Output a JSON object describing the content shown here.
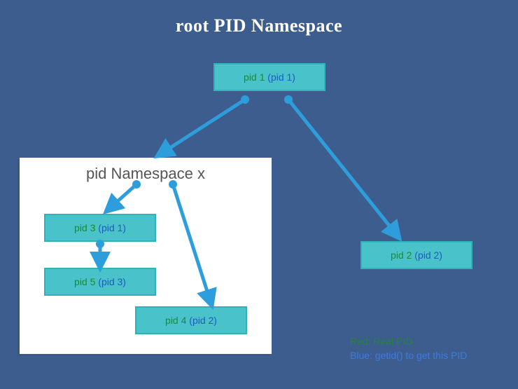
{
  "title": "root PID Namespace",
  "namespace_label": "pid Namespace x",
  "nodes": {
    "pid1": {
      "real": "pid 1",
      "virt": "(pid 1)"
    },
    "pid2": {
      "real": "pid 2",
      "virt": "(pid 2)"
    },
    "pid3": {
      "real": "pid 3",
      "virt": "(pid 1)"
    },
    "pid4": {
      "real": "pid 4",
      "virt": "(pid 2)"
    },
    "pid5": {
      "real": "pid 5",
      "virt": "(pid 3)"
    }
  },
  "legend": {
    "line1": "Red: Real PID",
    "line2": "Blue: getid() to get this PID"
  },
  "colors": {
    "background": "#3e5d8f",
    "node_fill": "#49c3c9",
    "node_border": "#2fb3b8",
    "arrow": "#2d9edb",
    "real_pid": "#1e8a2f",
    "virt_pid": "#1e5bbf",
    "title": "#ffffff"
  },
  "edges": [
    {
      "from": "pid1",
      "to": "pid3"
    },
    {
      "from": "pid1",
      "to": "pid2"
    },
    {
      "from": "namespace_x",
      "to": "pid3"
    },
    {
      "from": "namespace_x",
      "to": "pid4"
    },
    {
      "from": "pid3",
      "to": "pid5"
    }
  ]
}
